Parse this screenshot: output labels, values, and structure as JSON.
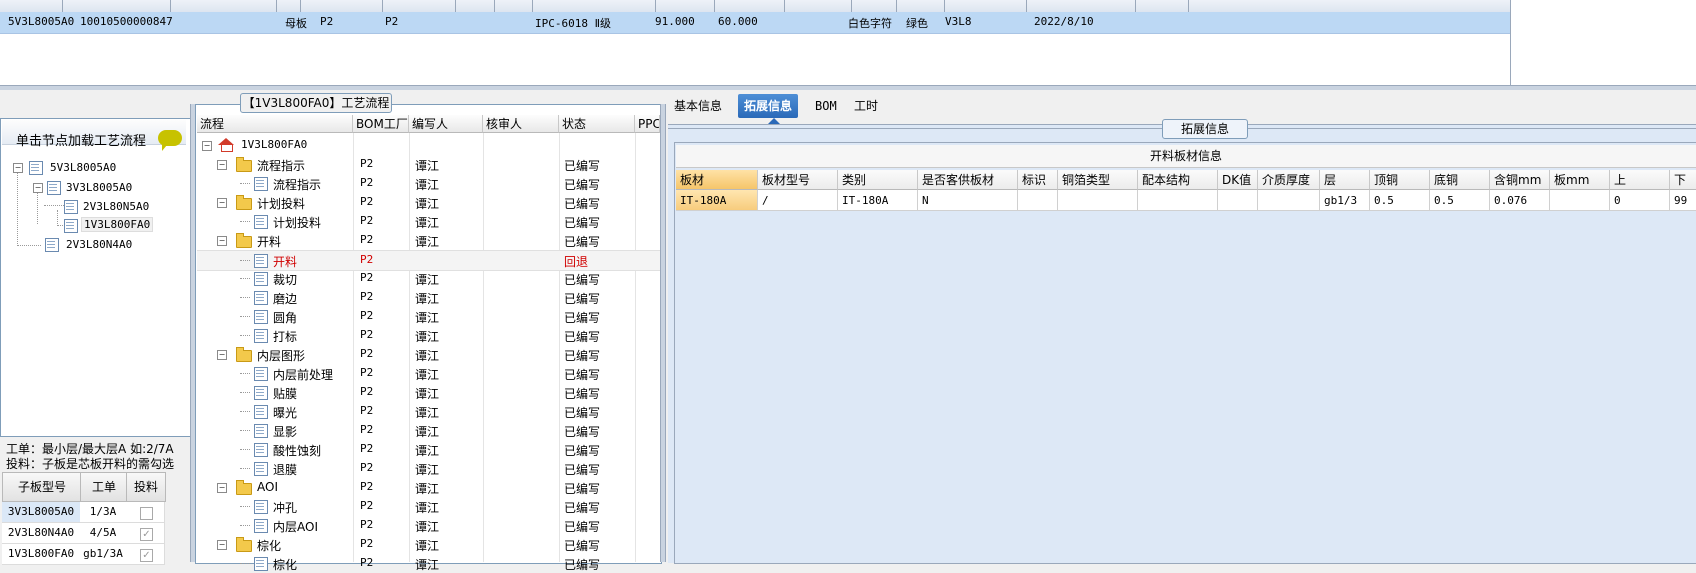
{
  "top_row": {
    "code": "5V3L8005A0",
    "id": "10010500000847",
    "board_type": "母板",
    "factory1": "P2",
    "factory2": "P2",
    "material": "IPC-6018 Ⅱ级",
    "v1": "91.000",
    "v2": "60.000",
    "silk": "白色字符",
    "mask": "绿色",
    "layer": "V3L8",
    "date": "2022/8/10"
  },
  "left": {
    "hint": "单击节点加载工艺流程",
    "tree": [
      "5V3L8005A0",
      "3V3L8005A0",
      "2V3L80N5A0",
      "1V3L800FA0",
      "2V3L80N4A0"
    ],
    "note1": "工单：最小层/最大层A 如:2/7A",
    "note2": "投料：子板是芯板开料的需勾选",
    "table": {
      "headers": [
        "子板型号",
        "工单",
        "投料"
      ],
      "rows": [
        {
          "model": "3V3L8005A0",
          "order": "1/3A",
          "checked": false
        },
        {
          "model": "2V3L80N4A0",
          "order": "4/5A",
          "checked": true
        },
        {
          "model": "1V3L800FA0",
          "order": "gb1/3A",
          "checked": true
        }
      ]
    }
  },
  "middle": {
    "title": "【1V3L800FA0】工艺流程",
    "headers": [
      "流程",
      "BOM工厂",
      "编写人",
      "核审人",
      "状态",
      "PPC"
    ],
    "root": "1V3L800FA0",
    "rows": [
      {
        "name": "流程指示",
        "level": 1,
        "factory": "P2",
        "author": "谭江",
        "status": "已编写"
      },
      {
        "name": "流程指示",
        "level": 2,
        "factory": "P2",
        "author": "谭江",
        "status": "已编写"
      },
      {
        "name": "计划投料",
        "level": 1,
        "factory": "P2",
        "author": "谭江",
        "status": "已编写"
      },
      {
        "name": "计划投料",
        "level": 2,
        "factory": "P2",
        "author": "谭江",
        "status": "已编写"
      },
      {
        "name": "开料",
        "level": 1,
        "factory": "P2",
        "author": "谭江",
        "status": "已编写"
      },
      {
        "name": "开料",
        "level": 2,
        "factory": "P2",
        "author": "",
        "status": "回退",
        "selected": true
      },
      {
        "name": "裁切",
        "level": 2,
        "factory": "P2",
        "author": "谭江",
        "status": "已编写"
      },
      {
        "name": "磨边",
        "level": 2,
        "factory": "P2",
        "author": "谭江",
        "status": "已编写"
      },
      {
        "name": "圆角",
        "level": 2,
        "factory": "P2",
        "author": "谭江",
        "status": "已编写"
      },
      {
        "name": "打标",
        "level": 2,
        "factory": "P2",
        "author": "谭江",
        "status": "已编写"
      },
      {
        "name": "内层图形",
        "level": 1,
        "factory": "P2",
        "author": "谭江",
        "status": "已编写"
      },
      {
        "name": "内层前处理",
        "level": 2,
        "factory": "P2",
        "author": "谭江",
        "status": "已编写"
      },
      {
        "name": "贴膜",
        "level": 2,
        "factory": "P2",
        "author": "谭江",
        "status": "已编写"
      },
      {
        "name": "曝光",
        "level": 2,
        "factory": "P2",
        "author": "谭江",
        "status": "已编写"
      },
      {
        "name": "显影",
        "level": 2,
        "factory": "P2",
        "author": "谭江",
        "status": "已编写"
      },
      {
        "name": "酸性蚀刻",
        "level": 2,
        "factory": "P2",
        "author": "谭江",
        "status": "已编写"
      },
      {
        "name": "退膜",
        "level": 2,
        "factory": "P2",
        "author": "谭江",
        "status": "已编写"
      },
      {
        "name": "AOI",
        "level": 1,
        "factory": "P2",
        "author": "谭江",
        "status": "已编写"
      },
      {
        "name": "冲孔",
        "level": 2,
        "factory": "P2",
        "author": "谭江",
        "status": "已编写"
      },
      {
        "name": "内层AOI",
        "level": 2,
        "factory": "P2",
        "author": "谭江",
        "status": "已编写"
      },
      {
        "name": "棕化",
        "level": 1,
        "factory": "P2",
        "author": "谭江",
        "status": "已编写"
      },
      {
        "name": "棕化",
        "level": 2,
        "factory": "P2",
        "author": "谭江",
        "status": "已编写"
      }
    ]
  },
  "right": {
    "tabs": [
      "基本信息",
      "拓展信息",
      "BOM",
      "工时"
    ],
    "active_tab": 1,
    "group_title": "拓展信息",
    "grid_title": "开料板材信息",
    "headers": [
      "板材",
      "板材型号",
      "类别",
      "是否客供板材",
      "标识",
      "铜箔类型",
      "配本结构",
      "DK值",
      "介质厚度",
      "层",
      "顶铜",
      "底铜",
      "含铜mm",
      "板mm",
      "上",
      "下"
    ],
    "row": [
      "IT-180A",
      "/",
      "IT-180A",
      "N",
      "",
      "",
      "",
      "",
      "",
      "gb1/3",
      "0.5",
      "0.5",
      "0.076",
      "",
      "0",
      "99"
    ]
  },
  "colors": {
    "selection": "#bcd8f4",
    "tab_active": "#2a69b8",
    "status_back": "#d00000"
  }
}
